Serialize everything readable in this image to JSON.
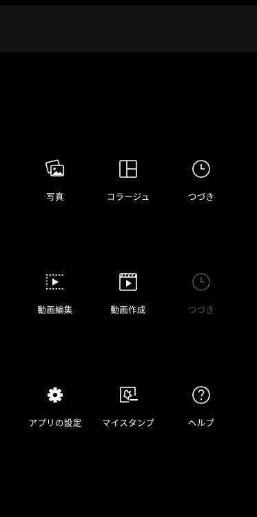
{
  "menu": {
    "row1": [
      {
        "label": "写真",
        "icon": "photo-icon"
      },
      {
        "label": "コラージュ",
        "icon": "collage-icon"
      },
      {
        "label": "つづき",
        "icon": "clock-icon"
      }
    ],
    "row2": [
      {
        "label": "動画編集",
        "icon": "video-edit-icon"
      },
      {
        "label": "動画作成",
        "icon": "clapperboard-icon"
      },
      {
        "label": "つづき",
        "icon": "clock-icon",
        "disabled": true
      }
    ],
    "row3": [
      {
        "label": "アプリの設定",
        "icon": "gear-icon"
      },
      {
        "label": "マイスタンプ",
        "icon": "stamp-icon"
      },
      {
        "label": "ヘルプ",
        "icon": "help-icon"
      }
    ]
  },
  "colors": {
    "background": "#000000",
    "top_band": "#141414",
    "icon": "#ffffff",
    "disabled": "#555555"
  }
}
